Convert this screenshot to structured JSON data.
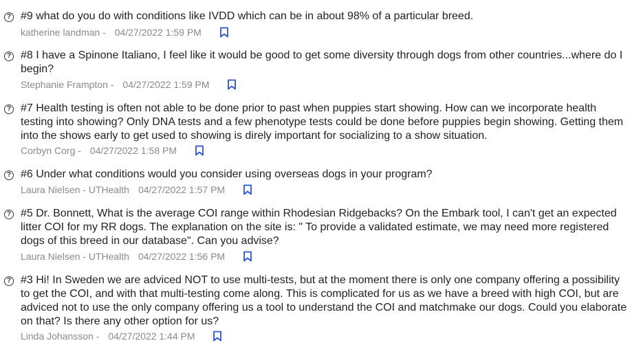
{
  "questions": [
    {
      "text": "#9 what do you do with conditions like IVDD which can be in about 98% of a particular breed.",
      "author": "katherine landman -",
      "timestamp": "04/27/2022 1:59 PM"
    },
    {
      "text": "#8 I have a Spinone Italiano, I feel like it would be good to get some diversity through dogs from other countries...where do I begin?",
      "author": "Stephanie Frampton -",
      "timestamp": "04/27/2022 1:59 PM"
    },
    {
      "text": "#7 Health testing is often not able to be done prior to past when puppies start showing. How can we incorporate health testing into showing? Only DNA tests and a few phenotype tests could be done before puppies begin showing. Getting them into the shows early to get used to showing is direly important for socializing to a show situation.",
      "author": "Corbyn Corg -",
      "timestamp": "04/27/2022 1:58 PM"
    },
    {
      "text": "#6 Under what conditions would you consider using overseas dogs in your program?",
      "author": "Laura Nielsen - UTHealth",
      "timestamp": "04/27/2022 1:57 PM"
    },
    {
      "text": "#5 Dr. Bonnett, What is the average COI range within Rhodesian Ridgebacks? On the Embark tool, I can't get an expected litter COI for my RR dogs. The explanation on the site is: \" To provide a validated estimate, we may need more registered dogs of this breed in our database\". Can you advise?",
      "author": "Laura Nielsen - UTHealth",
      "timestamp": "04/27/2022 1:56 PM"
    },
    {
      "text": "#3 Hi! In Sweden we are adviced NOT to use multi-tests, but at the moment there is only one company offering a possibility to get the COI, and with that multi-testing come along. This is complicated for us as we have a breed with high COI, but are adviced not to use the only company offering us a tool to understand the COI and matchmake our dogs. Could you elaborate on that? Is there any other option for us?",
      "author": "Linda Johansson -",
      "timestamp": "04/27/2022 1:44 PM"
    }
  ],
  "icons": {
    "question": "question-circle-icon",
    "bookmark": "bookmark-icon"
  },
  "colors": {
    "text": "#222222",
    "meta": "#8a8a8a",
    "bookmark": "#2952d9"
  }
}
